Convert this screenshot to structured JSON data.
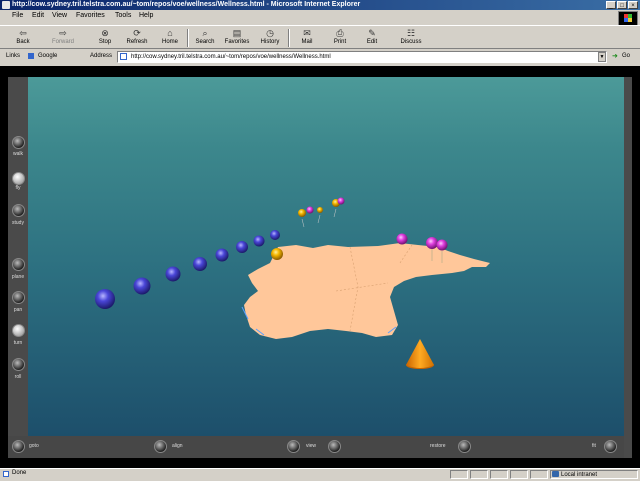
{
  "window": {
    "title": "http://cow.sydney.tril.telstra.com.au/~tom/repos/voe/wellness/Wellness.html - Microsoft Internet Explorer",
    "controls": [
      "_",
      "□",
      "×"
    ]
  },
  "menu": [
    "File",
    "Edit",
    "View",
    "Favorites",
    "Tools",
    "Help"
  ],
  "toolbar": [
    {
      "label": "Back",
      "icon": "back-arrow-icon",
      "glyph": "⇦"
    },
    {
      "label": "Forward",
      "icon": "forward-arrow-icon",
      "glyph": "⇨"
    },
    {
      "label": "Stop",
      "icon": "stop-icon",
      "glyph": "⊗"
    },
    {
      "label": "Refresh",
      "icon": "refresh-icon",
      "glyph": "⟳"
    },
    {
      "label": "Home",
      "icon": "home-icon",
      "glyph": "⌂"
    },
    {
      "label": "Search",
      "icon": "search-icon",
      "glyph": "⌕"
    },
    {
      "label": "Favorites",
      "icon": "favorites-icon",
      "glyph": "▤"
    },
    {
      "label": "History",
      "icon": "history-icon",
      "glyph": "◷"
    },
    {
      "label": "Mail",
      "icon": "mail-icon",
      "glyph": "✉"
    },
    {
      "label": "Print",
      "icon": "print-icon",
      "glyph": "⎙"
    },
    {
      "label": "Edit",
      "icon": "edit-icon",
      "glyph": "✎"
    },
    {
      "label": "Discuss",
      "icon": "discuss-icon",
      "glyph": "☷"
    }
  ],
  "links": {
    "label": "Links",
    "google": "Google"
  },
  "address": {
    "label": "Address",
    "value": "http://cow.sydney.tril.telstra.com.au/~tom/repos/voe/wellness/Wellness.html",
    "go": "Go"
  },
  "viewer": {
    "left_controls": [
      "walk",
      "fly",
      "study",
      "plane",
      "pan",
      "turn",
      "roll"
    ],
    "bottom_controls": {
      "goto": "goto",
      "align": "align",
      "view": "view",
      "restore": "restore",
      "fit": "fit"
    }
  },
  "status": {
    "text": "Done",
    "zone": "Local intranet"
  },
  "colors": {
    "sphere": "#4a46d8",
    "pin": "#e040e0",
    "gold": "#f5b800",
    "land": "#ffc79a",
    "cone": "#ff9a10"
  }
}
